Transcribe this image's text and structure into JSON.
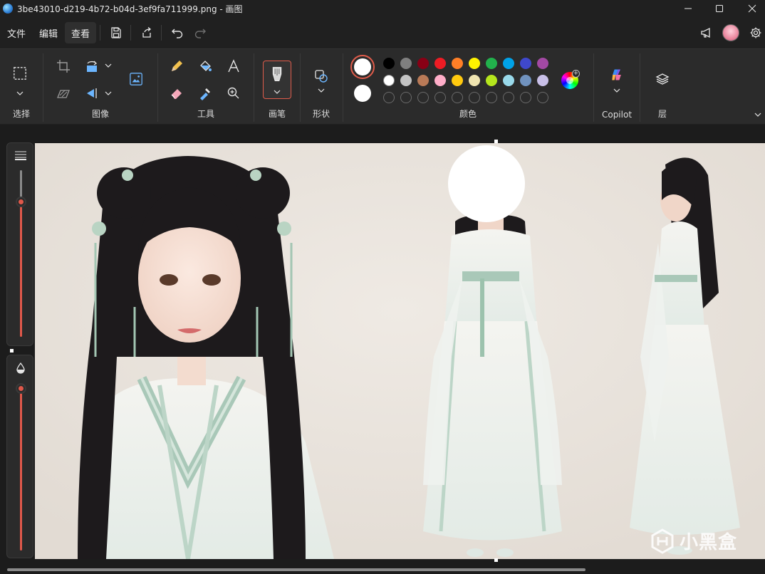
{
  "window": {
    "title": "3be43010-d219-4b72-b04d-3ef9fa711999.png - 画图"
  },
  "menu": {
    "file": "文件",
    "edit": "编辑",
    "view": "查看"
  },
  "ribbon": {
    "groups": {
      "select": "选择",
      "image": "图像",
      "tools": "工具",
      "brushes": "画笔",
      "shapes": "形状",
      "colors": "颜色",
      "copilot": "Copilot",
      "layers": "层"
    },
    "colors": {
      "current_primary": "#ffffff",
      "current_secondary": "#ffffff",
      "accent": "#e05c4b",
      "row1": [
        "#000000",
        "#7f7f7f",
        "#880015",
        "#ed1c24",
        "#ff7f27",
        "#fff200",
        "#22b14c",
        "#00a2e8",
        "#3f48cc",
        "#a349a4"
      ],
      "row2": [
        "#ffffff",
        "#c3c3c3",
        "#b97a57",
        "#ffaec9",
        "#ffc90e",
        "#efe4b0",
        "#b5e61d",
        "#99d9ea",
        "#7092be",
        "#c8bfe7"
      ]
    }
  },
  "side_sliders": {
    "size_level": 0.83,
    "opacity_level": 1.0
  },
  "watermark": {
    "text": "小黑盒"
  }
}
